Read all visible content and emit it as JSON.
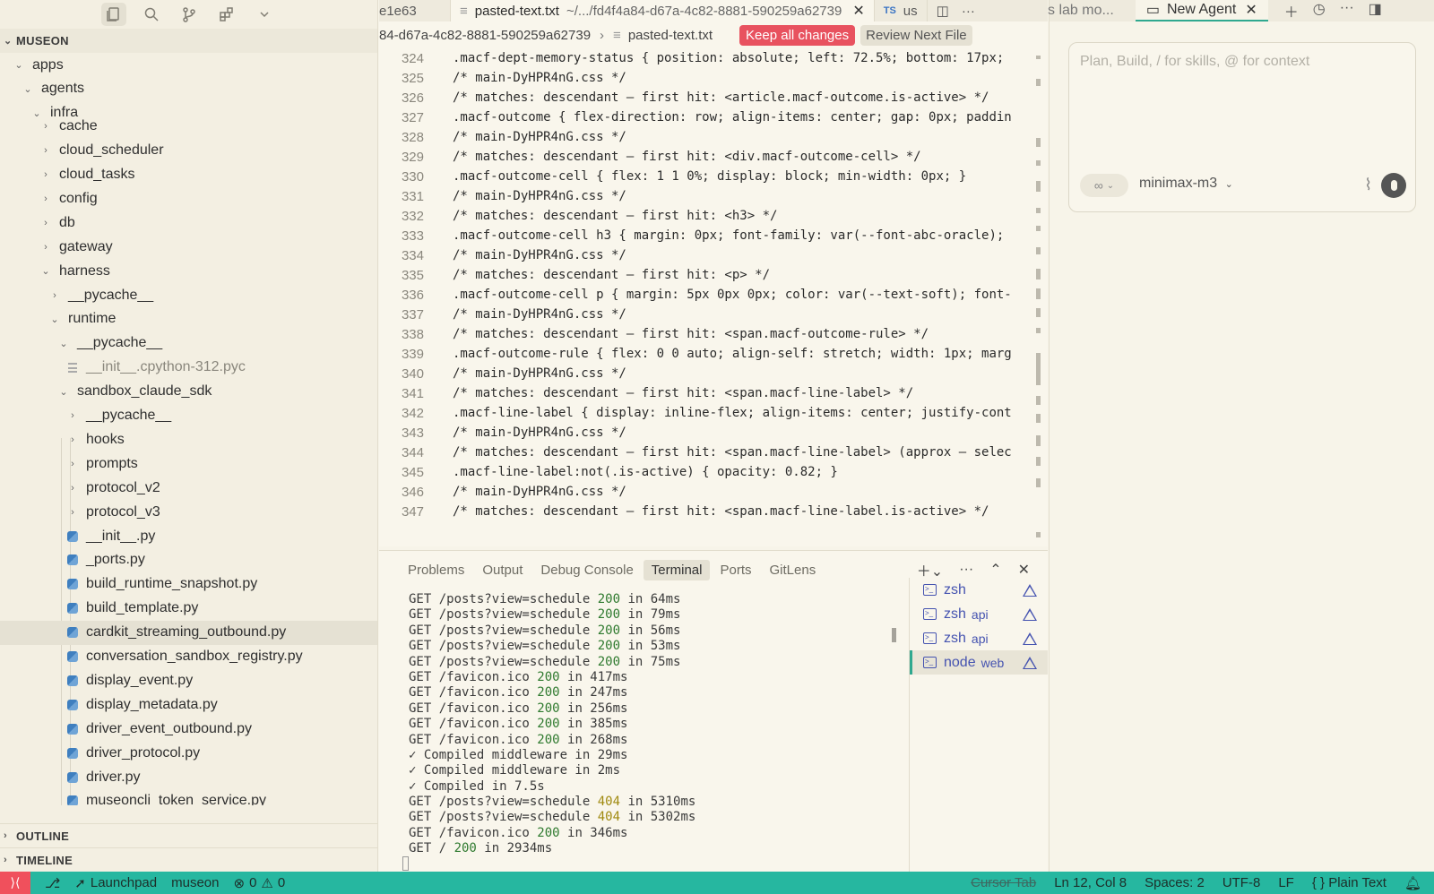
{
  "sidebar": {
    "explorer_title": "MUSEON",
    "tree": [
      {
        "label": "apps",
        "depth": 1,
        "twisty": "open",
        "icon": "folder"
      },
      {
        "label": "agents",
        "depth": 2,
        "twisty": "open",
        "icon": "folder"
      },
      {
        "label": "infra",
        "depth": 3,
        "twisty": "open",
        "icon": "folder"
      },
      {
        "label": "cache",
        "depth": 4,
        "twisty": "closed",
        "icon": "folder"
      },
      {
        "label": "cloud_scheduler",
        "depth": 4,
        "twisty": "closed",
        "icon": "folder"
      },
      {
        "label": "cloud_tasks",
        "depth": 4,
        "twisty": "closed",
        "icon": "folder"
      },
      {
        "label": "config",
        "depth": 4,
        "twisty": "closed",
        "icon": "folder"
      },
      {
        "label": "db",
        "depth": 4,
        "twisty": "closed",
        "icon": "folder"
      },
      {
        "label": "gateway",
        "depth": 4,
        "twisty": "closed",
        "icon": "folder"
      },
      {
        "label": "harness",
        "depth": 4,
        "twisty": "open",
        "icon": "folder"
      },
      {
        "label": "__pycache__",
        "depth": 5,
        "twisty": "closed",
        "icon": "folder"
      },
      {
        "label": "runtime",
        "depth": 5,
        "twisty": "open",
        "icon": "folder"
      },
      {
        "label": "__pycache__",
        "depth": 6,
        "twisty": "open",
        "icon": "folder"
      },
      {
        "label": "__init__.cpython-312.pyc",
        "depth": 7,
        "twisty": "none",
        "icon": "text-file-icon",
        "muted": true
      },
      {
        "label": "sandbox_claude_sdk",
        "depth": 6,
        "twisty": "open",
        "icon": "folder"
      },
      {
        "label": "__pycache__",
        "depth": 7,
        "twisty": "closed",
        "icon": "folder"
      },
      {
        "label": "hooks",
        "depth": 7,
        "twisty": "closed",
        "icon": "folder"
      },
      {
        "label": "prompts",
        "depth": 7,
        "twisty": "closed",
        "icon": "folder"
      },
      {
        "label": "protocol_v2",
        "depth": 7,
        "twisty": "closed",
        "icon": "folder"
      },
      {
        "label": "protocol_v3",
        "depth": 7,
        "twisty": "closed",
        "icon": "folder"
      },
      {
        "label": "__init__.py",
        "depth": 7,
        "twisty": "none",
        "icon": "python-file-icon"
      },
      {
        "label": "_ports.py",
        "depth": 7,
        "twisty": "none",
        "icon": "python-file-icon"
      },
      {
        "label": "build_runtime_snapshot.py",
        "depth": 7,
        "twisty": "none",
        "icon": "python-file-icon"
      },
      {
        "label": "build_template.py",
        "depth": 7,
        "twisty": "none",
        "icon": "python-file-icon"
      },
      {
        "label": "cardkit_streaming_outbound.py",
        "depth": 7,
        "twisty": "none",
        "icon": "python-file-icon",
        "selected": true
      },
      {
        "label": "conversation_sandbox_registry.py",
        "depth": 7,
        "twisty": "none",
        "icon": "python-file-icon"
      },
      {
        "label": "display_event.py",
        "depth": 7,
        "twisty": "none",
        "icon": "python-file-icon"
      },
      {
        "label": "display_metadata.py",
        "depth": 7,
        "twisty": "none",
        "icon": "python-file-icon"
      },
      {
        "label": "driver_event_outbound.py",
        "depth": 7,
        "twisty": "none",
        "icon": "python-file-icon"
      },
      {
        "label": "driver_protocol.py",
        "depth": 7,
        "twisty": "none",
        "icon": "python-file-icon"
      },
      {
        "label": "driver.py",
        "depth": 7,
        "twisty": "none",
        "icon": "python-file-icon"
      },
      {
        "label": "museoncli_token_service.py",
        "depth": 7,
        "twisty": "none",
        "icon": "python-file-icon"
      }
    ],
    "outline_title": "OUTLINE",
    "timeline_title": "TIMELINE"
  },
  "editor": {
    "tabs": {
      "prev_tab": "e1e63",
      "active_tab_name": "pasted-text.txt",
      "active_tab_path": "~/.../fd4f4a84-d67a-4c82-8881-590259a62739",
      "ts_badge": "TS",
      "ts_tab": "us"
    },
    "breadcrumb": {
      "folder": "84-d67a-4c82-8881-590259a62739",
      "file": "pasted-text.txt"
    },
    "keep_all_label": "Keep all changes",
    "review_next_label": "Review Next File",
    "lines": [
      {
        "n": "324",
        "t": ".macf-dept-memory-status { position: absolute; left: 72.5%; bottom: 17px;"
      },
      {
        "n": "325",
        "t": "/* main-DyHPR4nG.css */"
      },
      {
        "n": "326",
        "t": "/* matches: descendant — first hit: <article.macf-outcome.is-active> */"
      },
      {
        "n": "327",
        "t": ".macf-outcome { flex-direction: row; align-items: center; gap: 0px; paddin"
      },
      {
        "n": "328",
        "t": "/* main-DyHPR4nG.css */"
      },
      {
        "n": "329",
        "t": "/* matches: descendant — first hit: <div.macf-outcome-cell> */"
      },
      {
        "n": "330",
        "t": ".macf-outcome-cell { flex: 1 1 0%; display: block; min-width: 0px; }"
      },
      {
        "n": "331",
        "t": "/* main-DyHPR4nG.css */"
      },
      {
        "n": "332",
        "t": "/* matches: descendant — first hit: <h3> */"
      },
      {
        "n": "333",
        "t": ".macf-outcome-cell h3 { margin: 0px; font-family: var(--font-abc-oracle);"
      },
      {
        "n": "334",
        "t": "/* main-DyHPR4nG.css */"
      },
      {
        "n": "335",
        "t": "/* matches: descendant — first hit: <p> */"
      },
      {
        "n": "336",
        "t": ".macf-outcome-cell p { margin: 5px 0px 0px; color: var(--text-soft); font-"
      },
      {
        "n": "337",
        "t": "/* main-DyHPR4nG.css */"
      },
      {
        "n": "338",
        "t": "/* matches: descendant — first hit: <span.macf-outcome-rule> */"
      },
      {
        "n": "339",
        "t": ".macf-outcome-rule { flex: 0 0 auto; align-self: stretch; width: 1px; marg"
      },
      {
        "n": "340",
        "t": "/* main-DyHPR4nG.css */"
      },
      {
        "n": "341",
        "t": "/* matches: descendant — first hit: <span.macf-line-label> */"
      },
      {
        "n": "342",
        "t": ".macf-line-label { display: inline-flex; align-items: center; justify-cont"
      },
      {
        "n": "343",
        "t": "/* main-DyHPR4nG.css */"
      },
      {
        "n": "344",
        "t": "/* matches: descendant — first hit: <span.macf-line-label> (approx — selec"
      },
      {
        "n": "345",
        "t": ".macf-line-label:not(.is-active) { opacity: 0.82; }"
      },
      {
        "n": "346",
        "t": "/* main-DyHPR4nG.css */"
      },
      {
        "n": "347",
        "t": "/* matches: descendant — first hit: <span.macf-line-label.is-active> */"
      }
    ]
  },
  "panel": {
    "tabs": [
      "Problems",
      "Output",
      "Debug Console",
      "Terminal",
      "Ports",
      "GitLens"
    ],
    "active_tab": "Terminal",
    "terminal_lines": [
      {
        "pre": "GET /posts?view=schedule ",
        "code": "200",
        "post": " in 64ms"
      },
      {
        "pre": "GET /posts?view=schedule ",
        "code": "200",
        "post": " in 79ms"
      },
      {
        "pre": "GET /posts?view=schedule ",
        "code": "200",
        "post": " in 56ms"
      },
      {
        "pre": "GET /posts?view=schedule ",
        "code": "200",
        "post": " in 53ms"
      },
      {
        "pre": "GET /posts?view=schedule ",
        "code": "200",
        "post": " in 75ms"
      },
      {
        "pre": "GET /favicon.ico ",
        "code": "200",
        "post": " in 417ms"
      },
      {
        "pre": "GET /favicon.ico ",
        "code": "200",
        "post": " in 247ms"
      },
      {
        "pre": "GET /favicon.ico ",
        "code": "200",
        "post": " in 256ms"
      },
      {
        "pre": "GET /favicon.ico ",
        "code": "200",
        "post": " in 385ms"
      },
      {
        "pre": "GET /favicon.ico ",
        "code": "200",
        "post": " in 268ms"
      },
      {
        "pre": "✓ Compiled middleware in 29ms",
        "code": "",
        "post": ""
      },
      {
        "pre": "✓ Compiled middleware in 2ms",
        "code": "",
        "post": ""
      },
      {
        "pre": "✓ Compiled in 7.5s",
        "code": "",
        "post": ""
      },
      {
        "pre": "GET /posts?view=schedule ",
        "code": "404",
        "post": " in 5310ms"
      },
      {
        "pre": "GET /posts?view=schedule ",
        "code": "404",
        "post": " in 5302ms"
      },
      {
        "pre": "GET /favicon.ico ",
        "code": "200",
        "post": " in 346ms"
      },
      {
        "pre": "GET / ",
        "code": "200",
        "post": " in 2934ms"
      }
    ],
    "terminals": [
      {
        "name": "zsh",
        "sub": ""
      },
      {
        "name": "zsh",
        "sub": "api"
      },
      {
        "name": "zsh",
        "sub": "api"
      },
      {
        "name": "node",
        "sub": "web",
        "active": true
      }
    ]
  },
  "agent": {
    "prev_tab": "s lab mo...",
    "tab_label": "New Agent",
    "placeholder": "Plan, Build, / for skills, @ for context",
    "model": "minimax-m3"
  },
  "statusbar": {
    "launchpad": "Launchpad",
    "workspace": "museon",
    "errors": "0",
    "warnings": "0",
    "cursor_tab": "Cursor Tab",
    "position": "Ln 12, Col 8",
    "spaces": "Spaces: 2",
    "encoding": "UTF-8",
    "eol": "LF",
    "language": "Plain Text"
  },
  "colors": {
    "accent": "#26b7a0",
    "keep_button": "#e8525f",
    "status_200": "#2f7a2f",
    "status_404": "#a08a10"
  }
}
